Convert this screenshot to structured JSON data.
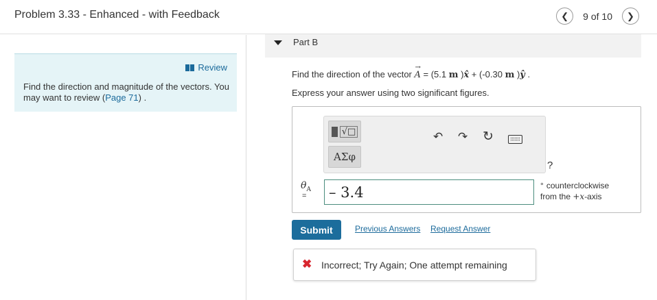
{
  "header": {
    "title": "Problem 3.33 - Enhanced - with Feedback",
    "prev_icon": "chevron-left",
    "next_icon": "chevron-right",
    "count": "9 of 10"
  },
  "review": {
    "link_label": "Review",
    "text_before": "Find the direction and magnitude of the vectors. You may want to review (",
    "page_link": "Page 71",
    "text_after": ") ."
  },
  "part": {
    "label": "Part B"
  },
  "question": {
    "prefix": "Find the direction of the vector ",
    "vector": "A",
    "eq": " = (5.1 ",
    "unit1": "m",
    "mid": " )",
    "xhat": "x̂",
    "plus": " + (-0.30 ",
    "unit2": "m",
    "mid2": " )",
    "yhat": "ŷ",
    "end": " .",
    "instruction": "Express your answer using two significant figures."
  },
  "toolbar": {
    "templates_icon": "templates-icon",
    "greek_label": "ΑΣφ",
    "undo_icon": "↶",
    "redo_icon": "↷",
    "reset_icon": "↻",
    "keyboard_icon": "keyboard-icon",
    "help_label": "?"
  },
  "answer": {
    "variable": "θ",
    "subscript": "A",
    "equals": "=",
    "value": "– 3.4",
    "unit_line1": "counterclockwise",
    "unit_line2_prefix": "from the ",
    "unit_line2_math": "+x",
    "unit_line2_suffix": "-axis",
    "degree": "°"
  },
  "actions": {
    "submit": "Submit",
    "previous_answers": "Previous Answers",
    "request_answer": "Request Answer"
  },
  "feedback": {
    "icon": "✖",
    "message": "Incorrect; Try Again; One attempt remaining"
  },
  "colors": {
    "accent": "#1c6d9c",
    "error": "#d8262f",
    "review_bg": "#e5f4f7"
  }
}
